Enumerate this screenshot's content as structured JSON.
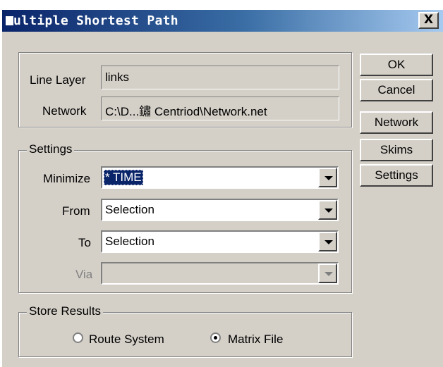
{
  "window": {
    "title": "ultiple Shortest Path",
    "close_label": "X"
  },
  "top_group": {
    "line_layer_label": "Line Layer",
    "line_layer_value": "links",
    "network_label": "Network",
    "network_value": "C:\\D...鏽 Centriod\\Network.net"
  },
  "settings_group": {
    "title": "Settings",
    "minimize_label": "Minimize",
    "minimize_value": "* TIME",
    "from_label": "From",
    "from_value": "Selection",
    "to_label": "To",
    "to_value": "Selection",
    "via_label": "Via",
    "via_value": ""
  },
  "store_group": {
    "title": "Store Results",
    "route_system_label": "Route System",
    "matrix_file_label": "Matrix File",
    "selected": "Matrix File"
  },
  "buttons": {
    "ok": "OK",
    "cancel": "Cancel",
    "network": "Network",
    "skims": "Skims",
    "settings": "Settings"
  }
}
